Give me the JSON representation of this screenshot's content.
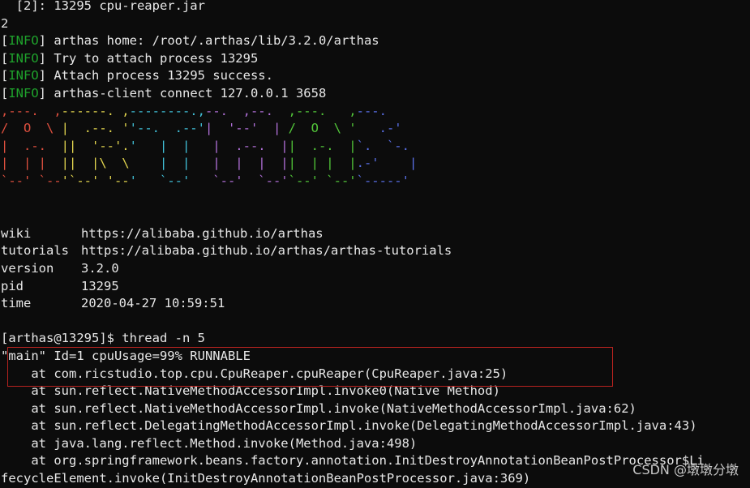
{
  "terminal": {
    "top_line": "  [2]: 13295 cpu-reaper.jar",
    "choice": "2",
    "info_tag": "INFO",
    "info_lines": [
      "arthas home: /root/.arthas/lib/3.2.0/arthas",
      "Try to attach process 13295",
      "Attach process 13295 success.",
      "arthas-client connect 127.0.0.1 3658"
    ],
    "banner": [
      ",---.  ,------. ,--------.,--.  ,--.  ,---.   ,---.",
      "/  O  \\ |  .--. ''--.  .--'|  '--'  | /  O  \\ '   .-'",
      "|  .-.  ||  '--'.'   |  |   |  .--.  ||  .-.  |`.  `-.",
      "|  | |  ||  |\\  \\    |  |   |  |  |  ||  | |  |.-'    |",
      "`--' `--'`--' '--'   `--'   `--'  `--'`--' `--'`-----'"
    ],
    "info_kv": [
      {
        "key": "wiki",
        "value": "https://alibaba.github.io/arthas"
      },
      {
        "key": "tutorials",
        "value": "https://alibaba.github.io/arthas/arthas-tutorials"
      },
      {
        "key": "version",
        "value": "3.2.0"
      },
      {
        "key": "pid",
        "value": "13295"
      },
      {
        "key": "time",
        "value": "2020-04-27 10:59:51"
      }
    ],
    "prompt": "[arthas@13295]$ thread -n 5",
    "thread_header": "\"main\" Id=1 cpuUsage=99% RUNNABLE",
    "stack": [
      "    at com.ricstudio.top.cpu.CpuReaper.cpuReaper(CpuReaper.java:25)",
      "    at sun.reflect.NativeMethodAccessorImpl.invoke0(Native Method)",
      "    at sun.reflect.NativeMethodAccessorImpl.invoke(NativeMethodAccessorImpl.java:62)",
      "    at sun.reflect.DelegatingMethodAccessorImpl.invoke(DelegatingMethodAccessorImpl.java:43)",
      "    at java.lang.reflect.Method.invoke(Method.java:498)",
      "    at org.springframework.beans.factory.annotation.InitDestroyAnnotationBeanPostProcessor$Li",
      "fecycleElement.invoke(InitDestroyAnnotationBeanPostProcessor.java:369)"
    ]
  },
  "watermark": "CSDN @墩墩分墩",
  "colors": {
    "background": "#0c0c0c",
    "text": "#e8e8e8",
    "info": "#1fa32c",
    "highlight_box": "#b8231f"
  }
}
